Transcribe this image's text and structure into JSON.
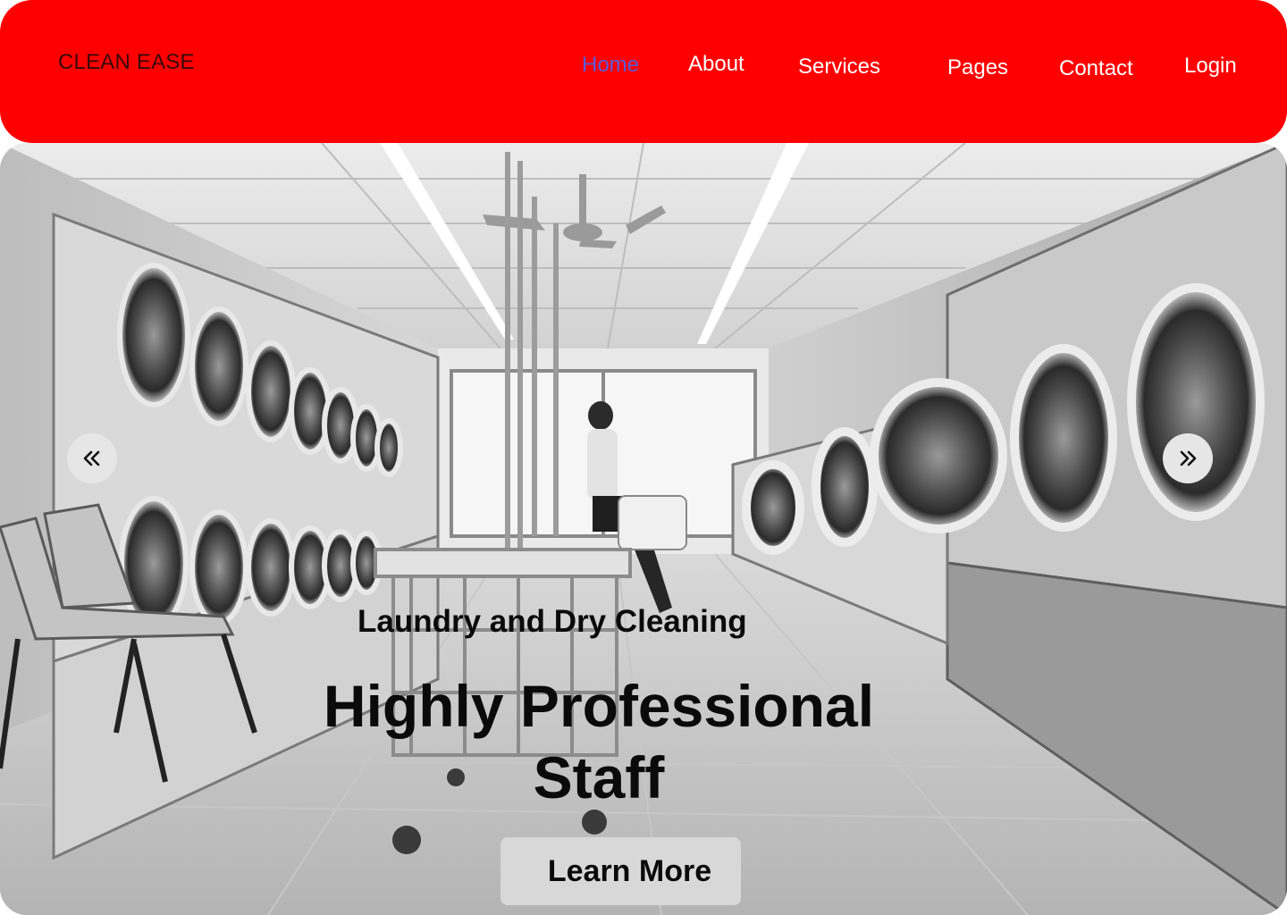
{
  "brand": {
    "name": "CLEAN EASE"
  },
  "nav": {
    "active": "Home",
    "items": [
      "Home",
      "About",
      "Services",
      "Pages",
      "Contact",
      "Login"
    ]
  },
  "colors": {
    "navbar_bg": "#ff0000",
    "nav_active": "#5b5bd6",
    "nav_text": "#ffffff",
    "button_bg": "#d8d8d8"
  },
  "hero": {
    "image": "black-and-white-laundromat-photo",
    "subtitle": "Laundry and Dry Cleaning",
    "title": "Highly Professional Staff",
    "cta_label": "Learn More",
    "prev_icon": "double-chevron-left-icon",
    "next_icon": "double-chevron-right-icon"
  }
}
